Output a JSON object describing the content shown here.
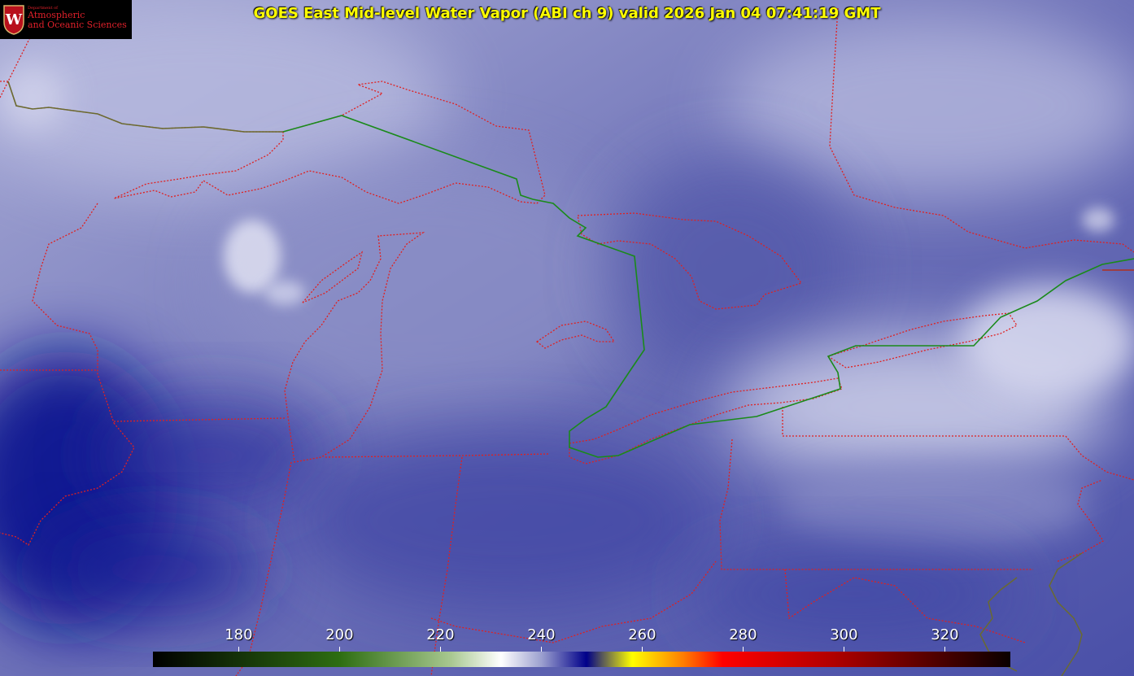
{
  "header": {
    "title": "GOES East Mid-level Water Vapor (ABI ch 9)  valid 2026 Jan 04 07:41:19 GMT"
  },
  "logo": {
    "dept": "Department of",
    "line1": "Atmospheric",
    "line2": "and Oceanic Sciences",
    "seal_letter": "W"
  },
  "colorbar": {
    "min": 163,
    "max": 333,
    "ticks": [
      "180",
      "200",
      "220",
      "240",
      "260",
      "280",
      "300",
      "320"
    ],
    "stops": [
      {
        "v": 163,
        "c": "#000000"
      },
      {
        "v": 200,
        "c": "#2e6e12"
      },
      {
        "v": 222,
        "c": "#a8c890"
      },
      {
        "v": 232,
        "c": "#ffffff"
      },
      {
        "v": 240,
        "c": "#9da1d0"
      },
      {
        "v": 249,
        "c": "#00008a"
      },
      {
        "v": 258,
        "c": "#ffff00"
      },
      {
        "v": 268,
        "c": "#ff8000"
      },
      {
        "v": 276,
        "c": "#ff0000"
      },
      {
        "v": 298,
        "c": "#b00000"
      },
      {
        "v": 333,
        "c": "#0a0000"
      }
    ]
  },
  "colors": {
    "state_borders": "#e02020",
    "canada_us_border": "#1a8a1a",
    "coast": "#6a6a30"
  }
}
